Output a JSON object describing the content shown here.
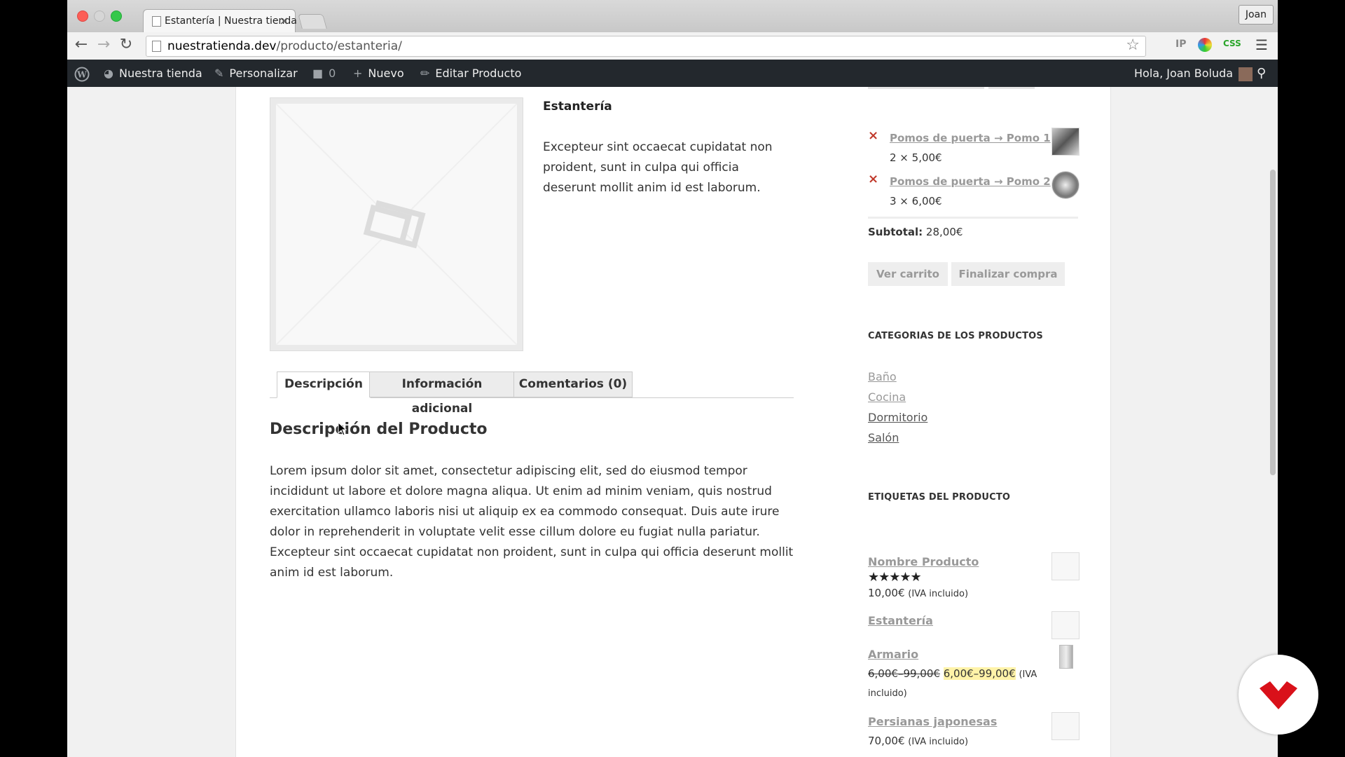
{
  "browser": {
    "tab_title": "Estantería | Nuestra tienda",
    "tab_close": "×",
    "profile_name": "Joan",
    "url_host": "nuestratienda.dev",
    "url_path": "/producto/estanteria/",
    "ext_ip": "IP",
    "ext_css": "CSS"
  },
  "adminbar": {
    "site_name": "Nuestra tienda",
    "customize": "Personalizar",
    "comments_count": "0",
    "new": "Nuevo",
    "edit_product": "Editar Producto",
    "greeting": "Hola, Joan Boluda"
  },
  "product": {
    "title": "Estantería",
    "short_description": "Excepteur sint occaecat cupidatat non proident, sunt in culpa qui officia deserunt mollit anim id est laborum.",
    "tabs": [
      "Descripción",
      "Información adicional",
      "Comentarios (0)"
    ],
    "description_heading": "Descripción del Producto",
    "description": "Lorem ipsum dolor sit amet, consectetur adipiscing elit, sed do eiusmod tempor incididunt ut labore et dolore magna aliqua. Ut enim ad minim veniam, quis nostrud exercitation ullamco laboris nisi ut aliquip ex ea commodo consequat. Duis aute irure dolor in reprehenderit in voluptate velit esse cillum dolore eu fugiat nulla pariatur. Excepteur sint occaecat cupidatat non proident, sunt in culpa qui officia deserunt mollit anim id est laborum."
  },
  "cart": {
    "remove_symbol": "×",
    "items": [
      {
        "name": "Pomos de puerta → Pomo 1",
        "qty": "2 × 5,00€"
      },
      {
        "name": "Pomos de puerta → Pomo 2",
        "qty": "3 × 6,00€"
      }
    ],
    "subtotal_label": "Subtotal:",
    "subtotal_value": "28,00€",
    "view_cart": "Ver carrito",
    "checkout": "Finalizar compra"
  },
  "categories": {
    "title": "CATEGORIAS DE LOS PRODUCTOS",
    "items": [
      "Baño",
      "Cocina",
      "Dormitorio",
      "Salón"
    ]
  },
  "tags": {
    "title": "ETIQUETAS DEL PRODUCTO"
  },
  "products_list": [
    {
      "name": "Nombre Producto",
      "rating": "★★★★★",
      "price": "10,00€",
      "tax": "(IVA incluido)"
    },
    {
      "name": "Estantería"
    },
    {
      "name": "Armario",
      "old_price": "6,00€–99,00€",
      "price": "6,00€–99,00€",
      "tax": "(IVA",
      "tax2": "incluido)"
    },
    {
      "name": "Persianas japonesas",
      "price": "70,00€",
      "tax": "(IVA incluido)"
    }
  ],
  "colors": {
    "admin_bar": "#23282d",
    "remove_red": "#c0392b",
    "sale_highlight": "#fff3a8",
    "brand_red": "#d9111a"
  }
}
